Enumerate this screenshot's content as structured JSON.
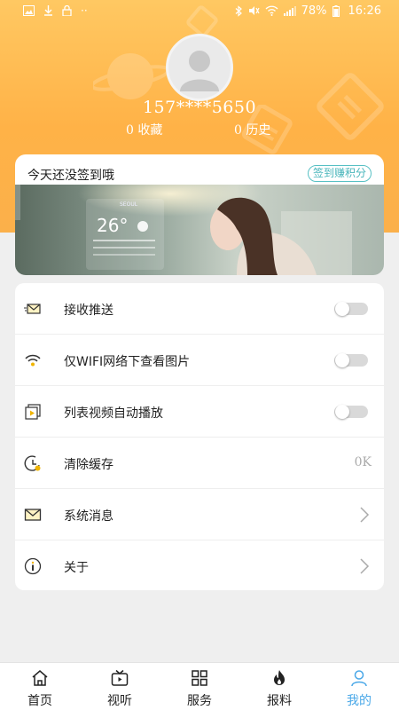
{
  "status_bar": {
    "battery": "78%",
    "time": "16:26"
  },
  "profile": {
    "phone": "157****5650",
    "favorites_count": "0",
    "favorites_label": "收藏",
    "history_count": "0",
    "history_label": "历史"
  },
  "checkin": {
    "title": "今天还没签到哦",
    "button_label": "签到赚积分",
    "banner": {
      "city": "SEOUL",
      "temperature": "26°"
    }
  },
  "settings": [
    {
      "icon": "envelope-send-icon",
      "label": "接收推送",
      "control": "toggle",
      "on": false
    },
    {
      "icon": "wifi-icon",
      "label": "仅WIFI网络下查看图片",
      "control": "toggle",
      "on": false
    },
    {
      "icon": "video-icon",
      "label": "列表视频自动播放",
      "control": "toggle",
      "on": false
    },
    {
      "icon": "clock-clear-icon",
      "label": "清除缓存",
      "control": "value",
      "value": "0K"
    },
    {
      "icon": "mail-icon",
      "label": "系统消息",
      "control": "chevron"
    },
    {
      "icon": "info-icon",
      "label": "关于",
      "control": "chevron"
    }
  ],
  "tabs": [
    {
      "icon": "home-icon",
      "label": "首页",
      "active": false
    },
    {
      "icon": "tv-icon",
      "label": "视听",
      "active": false
    },
    {
      "icon": "grid-icon",
      "label": "服务",
      "active": false
    },
    {
      "icon": "flame-icon",
      "label": "报料",
      "active": false
    },
    {
      "icon": "person-icon",
      "label": "我的",
      "active": true
    }
  ],
  "colors": {
    "header_top": "#ffc862",
    "header_bottom": "#fbb04a",
    "accent_teal": "#48b5bb",
    "active_tab": "#4aa8e8",
    "page_bg": "#efefef"
  }
}
